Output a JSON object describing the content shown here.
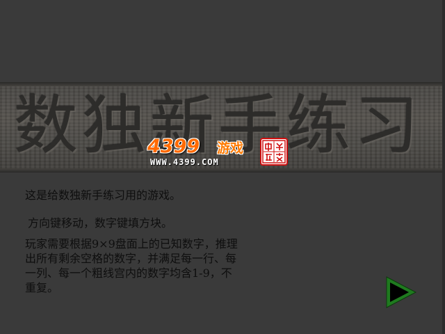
{
  "title": {
    "text": "数独新手练习"
  },
  "logo": {
    "brand": "4399",
    "game_word": "游戏",
    "url": "WWW.4399.COM",
    "seal_text": "中文游友"
  },
  "instructions": {
    "intro": "这是给数独新手练习用的游戏。",
    "controls": "方向键移动，数字键填方块。",
    "rules_lines": [
      "玩家需要根据9×9盘面上的已知数字，推理",
      "出所有剩余空格的数字，并满足每一行、每",
      "一列、每一个粗线宫内的数字均含1-9，不",
      "重复。"
    ]
  },
  "next_button": {
    "icon": "play-triangle-icon"
  },
  "colors": {
    "background": "#3a3a3a",
    "banner_stone": "#4f4c48",
    "title_engraved": "#2d2c2a",
    "body_text": "#0e0e0e",
    "logo_orange": "#ff6a00",
    "seal_red": "#d01010",
    "button_green": "#1f7a1f",
    "button_fill": "#000000"
  }
}
